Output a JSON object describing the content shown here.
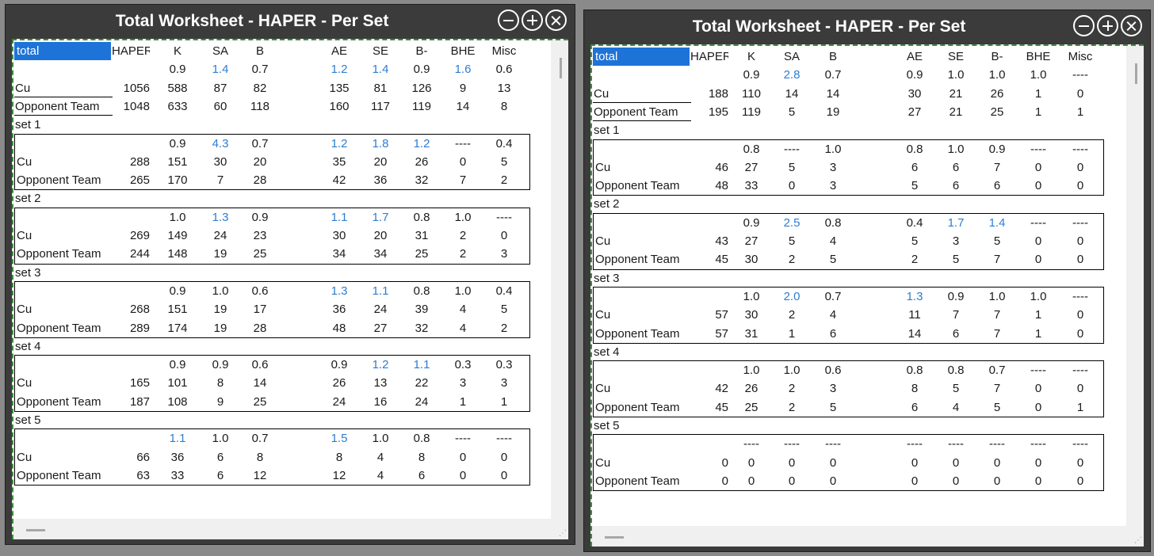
{
  "headers": [
    "HAPER",
    "K",
    "SA",
    "B",
    "AE",
    "SE",
    "B-",
    "BHE",
    "Misc"
  ],
  "window_controls": [
    "minimize",
    "maximize",
    "close"
  ],
  "accent_colors": {
    "highlight": "#1e73d8",
    "blue_value": "#2d7dd2"
  },
  "windows": [
    {
      "title": "Total Worksheet - HAPER - Per Set",
      "total_label": "total",
      "total": {
        "ratio": [
          null,
          "0.9",
          "1.4",
          "0.7",
          "1.2",
          "1.4",
          "0.9",
          "1.6",
          "0.6"
        ],
        "ratio_blue": [
          false,
          false,
          true,
          false,
          true,
          true,
          false,
          true,
          false
        ],
        "rows": [
          {
            "label": "Cu",
            "values": [
              "1056",
              "588",
              "87",
              "82",
              "135",
              "81",
              "126",
              "9",
              "13"
            ]
          },
          {
            "label": "Opponent Team",
            "values": [
              "1048",
              "633",
              "60",
              "118",
              "160",
              "117",
              "119",
              "14",
              "8"
            ]
          }
        ]
      },
      "sets": [
        {
          "label": "set 1",
          "ratio": [
            null,
            "0.9",
            "4.3",
            "0.7",
            "1.2",
            "1.8",
            "1.2",
            "----",
            "0.4"
          ],
          "ratio_blue": [
            false,
            false,
            true,
            false,
            true,
            true,
            true,
            false,
            false
          ],
          "rows": [
            {
              "label": "Cu",
              "values": [
                "288",
                "151",
                "30",
                "20",
                "35",
                "20",
                "26",
                "0",
                "5"
              ]
            },
            {
              "label": "Opponent Team",
              "values": [
                "265",
                "170",
                "7",
                "28",
                "42",
                "36",
                "32",
                "7",
                "2"
              ]
            }
          ]
        },
        {
          "label": "set 2",
          "ratio": [
            null,
            "1.0",
            "1.3",
            "0.9",
            "1.1",
            "1.7",
            "0.8",
            "1.0",
            "----"
          ],
          "ratio_blue": [
            false,
            false,
            true,
            false,
            true,
            true,
            false,
            false,
            false
          ],
          "rows": [
            {
              "label": "Cu",
              "values": [
                "269",
                "149",
                "24",
                "23",
                "30",
                "20",
                "31",
                "2",
                "0"
              ]
            },
            {
              "label": "Opponent Team",
              "values": [
                "244",
                "148",
                "19",
                "25",
                "34",
                "34",
                "25",
                "2",
                "3"
              ]
            }
          ]
        },
        {
          "label": "set 3",
          "ratio": [
            null,
            "0.9",
            "1.0",
            "0.6",
            "1.3",
            "1.1",
            "0.8",
            "1.0",
            "0.4"
          ],
          "ratio_blue": [
            false,
            false,
            false,
            false,
            true,
            true,
            false,
            false,
            false
          ],
          "rows": [
            {
              "label": "Cu",
              "values": [
                "268",
                "151",
                "19",
                "17",
                "36",
                "24",
                "39",
                "4",
                "5"
              ]
            },
            {
              "label": "Opponent Team",
              "values": [
                "289",
                "174",
                "19",
                "28",
                "48",
                "27",
                "32",
                "4",
                "2"
              ]
            }
          ]
        },
        {
          "label": "set 4",
          "ratio": [
            null,
            "0.9",
            "0.9",
            "0.6",
            "0.9",
            "1.2",
            "1.1",
            "0.3",
            "0.3"
          ],
          "ratio_blue": [
            false,
            false,
            false,
            false,
            false,
            true,
            true,
            false,
            false
          ],
          "rows": [
            {
              "label": "Cu",
              "values": [
                "165",
                "101",
                "8",
                "14",
                "26",
                "13",
                "22",
                "3",
                "3"
              ]
            },
            {
              "label": "Opponent Team",
              "values": [
                "187",
                "108",
                "9",
                "25",
                "24",
                "16",
                "24",
                "1",
                "1"
              ]
            }
          ]
        },
        {
          "label": "set 5",
          "ratio": [
            null,
            "1.1",
            "1.0",
            "0.7",
            "1.5",
            "1.0",
            "0.8",
            "----",
            "----"
          ],
          "ratio_blue": [
            false,
            true,
            false,
            false,
            true,
            false,
            false,
            false,
            false
          ],
          "rows": [
            {
              "label": "Cu",
              "values": [
                "66",
                "36",
                "6",
                "8",
                "8",
                "4",
                "8",
                "0",
                "0"
              ]
            },
            {
              "label": "Opponent Team",
              "values": [
                "63",
                "33",
                "6",
                "12",
                "12",
                "4",
                "6",
                "0",
                "0"
              ]
            }
          ]
        }
      ]
    },
    {
      "title": "Total Worksheet - HAPER - Per Set",
      "total_label": "total",
      "total": {
        "ratio": [
          null,
          "0.9",
          "2.8",
          "0.7",
          "0.9",
          "1.0",
          "1.0",
          "1.0",
          "----"
        ],
        "ratio_blue": [
          false,
          false,
          true,
          false,
          false,
          false,
          false,
          false,
          false
        ],
        "rows": [
          {
            "label": "Cu",
            "values": [
              "188",
              "110",
              "14",
              "14",
              "30",
              "21",
              "26",
              "1",
              "0"
            ]
          },
          {
            "label": "Opponent Team",
            "values": [
              "195",
              "119",
              "5",
              "19",
              "27",
              "21",
              "25",
              "1",
              "1"
            ]
          }
        ]
      },
      "sets": [
        {
          "label": "set 1",
          "ratio": [
            null,
            "0.8",
            "----",
            "1.0",
            "0.8",
            "1.0",
            "0.9",
            "----",
            "----"
          ],
          "ratio_blue": [
            false,
            false,
            false,
            false,
            false,
            false,
            false,
            false,
            false
          ],
          "rows": [
            {
              "label": "Cu",
              "values": [
                "46",
                "27",
                "5",
                "3",
                "6",
                "6",
                "7",
                "0",
                "0"
              ]
            },
            {
              "label": "Opponent Team",
              "values": [
                "48",
                "33",
                "0",
                "3",
                "5",
                "6",
                "6",
                "0",
                "0"
              ]
            }
          ]
        },
        {
          "label": "set 2",
          "ratio": [
            null,
            "0.9",
            "2.5",
            "0.8",
            "0.4",
            "1.7",
            "1.4",
            "----",
            "----"
          ],
          "ratio_blue": [
            false,
            false,
            true,
            false,
            false,
            true,
            true,
            false,
            false
          ],
          "rows": [
            {
              "label": "Cu",
              "values": [
                "43",
                "27",
                "5",
                "4",
                "5",
                "3",
                "5",
                "0",
                "0"
              ]
            },
            {
              "label": "Opponent Team",
              "values": [
                "45",
                "30",
                "2",
                "5",
                "2",
                "5",
                "7",
                "0",
                "0"
              ]
            }
          ]
        },
        {
          "label": "set 3",
          "ratio": [
            null,
            "1.0",
            "2.0",
            "0.7",
            "1.3",
            "0.9",
            "1.0",
            "1.0",
            "----"
          ],
          "ratio_blue": [
            false,
            false,
            true,
            false,
            true,
            false,
            false,
            false,
            false
          ],
          "rows": [
            {
              "label": "Cu",
              "values": [
                "57",
                "30",
                "2",
                "4",
                "11",
                "7",
                "7",
                "1",
                "0"
              ]
            },
            {
              "label": "Opponent Team",
              "values": [
                "57",
                "31",
                "1",
                "6",
                "14",
                "6",
                "7",
                "1",
                "0"
              ]
            }
          ]
        },
        {
          "label": "set 4",
          "ratio": [
            null,
            "1.0",
            "1.0",
            "0.6",
            "0.8",
            "0.8",
            "0.7",
            "----",
            "----"
          ],
          "ratio_blue": [
            false,
            false,
            false,
            false,
            false,
            false,
            false,
            false,
            false
          ],
          "rows": [
            {
              "label": "Cu",
              "values": [
                "42",
                "26",
                "2",
                "3",
                "8",
                "5",
                "7",
                "0",
                "0"
              ]
            },
            {
              "label": "Opponent Team",
              "values": [
                "45",
                "25",
                "2",
                "5",
                "6",
                "4",
                "5",
                "0",
                "1"
              ]
            }
          ]
        },
        {
          "label": "set 5",
          "ratio": [
            null,
            "----",
            "----",
            "----",
            "----",
            "----",
            "----",
            "----",
            "----"
          ],
          "ratio_blue": [
            false,
            false,
            false,
            false,
            false,
            false,
            false,
            false,
            false
          ],
          "rows": [
            {
              "label": "Cu",
              "values": [
                "0",
                "0",
                "0",
                "0",
                "0",
                "0",
                "0",
                "0",
                "0"
              ]
            },
            {
              "label": "Opponent Team",
              "values": [
                "0",
                "0",
                "0",
                "0",
                "0",
                "0",
                "0",
                "0",
                "0"
              ]
            }
          ]
        }
      ]
    }
  ]
}
